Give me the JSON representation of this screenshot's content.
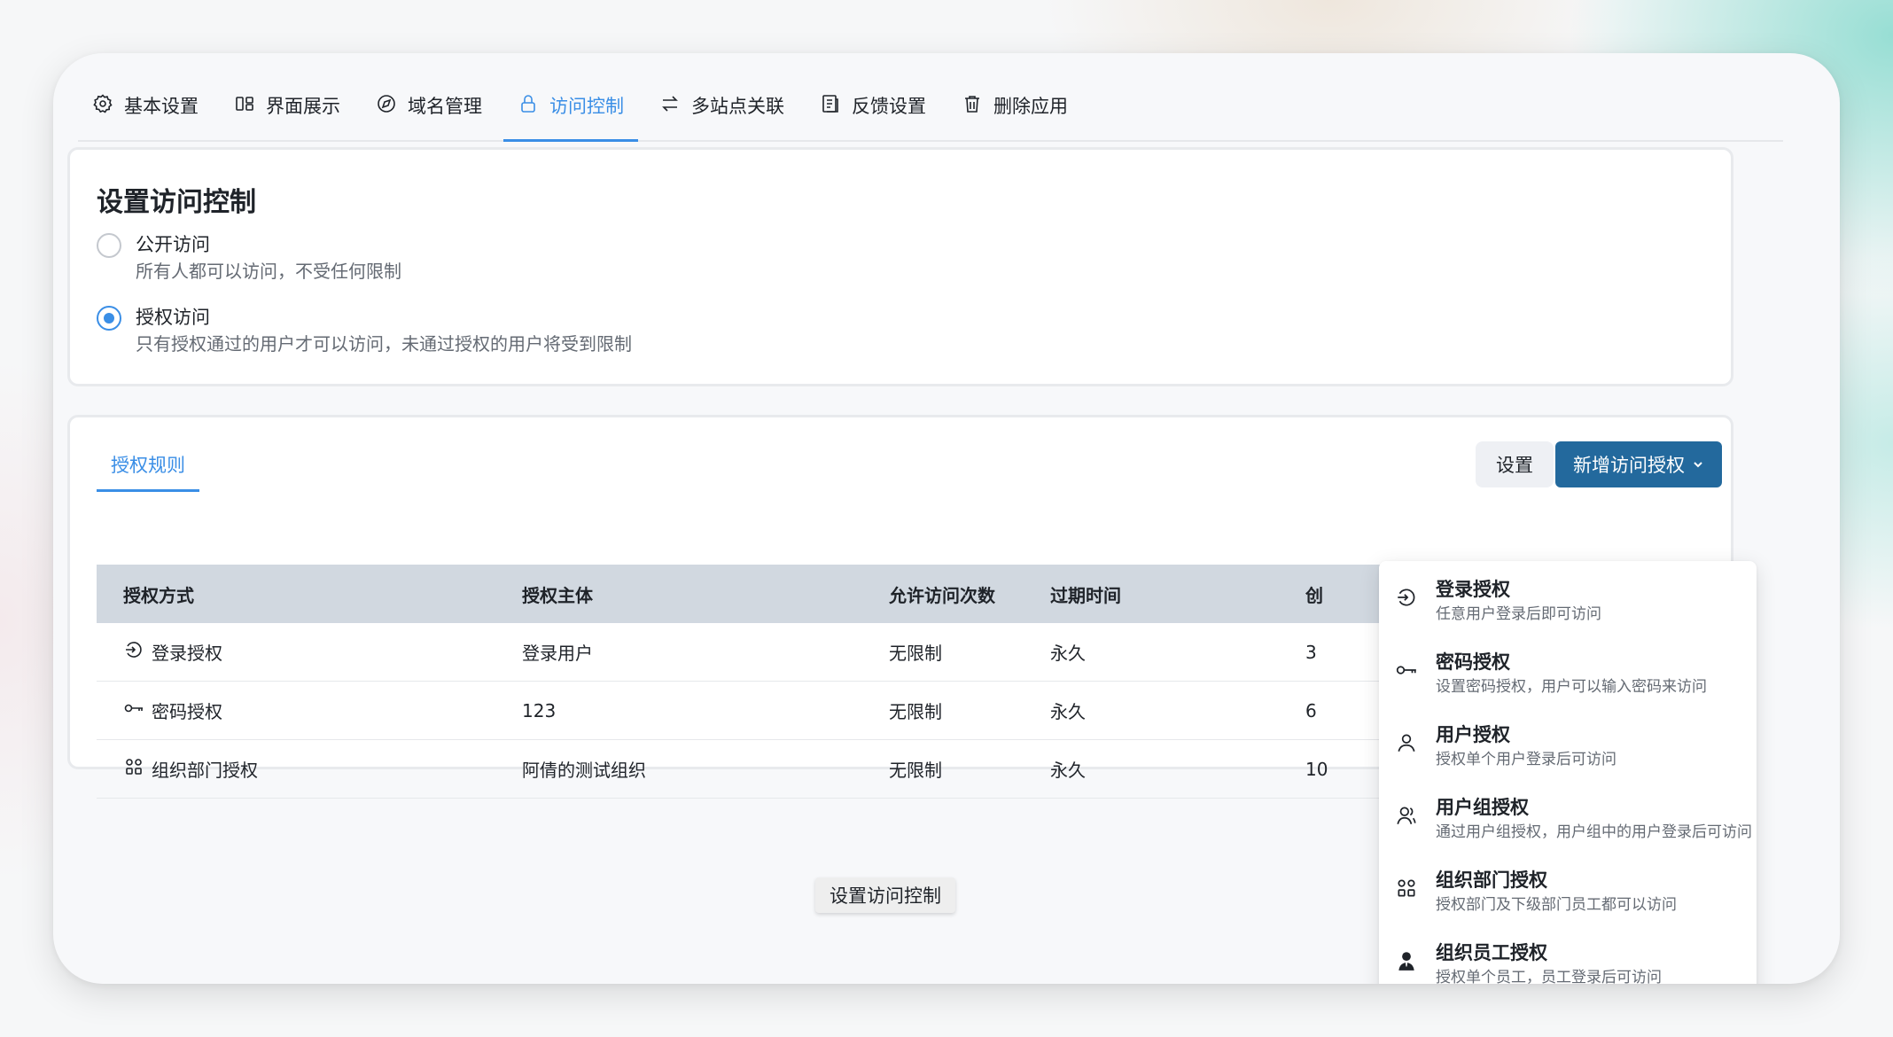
{
  "tabs": [
    {
      "label": "基本设置",
      "icon": "gear-icon"
    },
    {
      "label": "界面展示",
      "icon": "layout-icon"
    },
    {
      "label": "域名管理",
      "icon": "compass-icon"
    },
    {
      "label": "访问控制",
      "icon": "lock-icon",
      "active": true
    },
    {
      "label": "多站点关联",
      "icon": "swap-icon"
    },
    {
      "label": "反馈设置",
      "icon": "document-icon"
    },
    {
      "label": "删除应用",
      "icon": "trash-icon"
    }
  ],
  "access": {
    "title": "设置访问控制",
    "options": [
      {
        "label": "公开访问",
        "desc": "所有人都可以访问，不受任何限制",
        "checked": false
      },
      {
        "label": "授权访问",
        "desc": "只有授权通过的用户才可以访问，未通过授权的用户将受到限制",
        "checked": true
      }
    ]
  },
  "rules": {
    "tab_label": "授权规则",
    "settings_label": "设置",
    "add_label": "新增访问授权",
    "columns": [
      "授权方式",
      "授权主体",
      "允许访问次数",
      "过期时间",
      "创"
    ],
    "rows": [
      {
        "type": "登录授权",
        "icon": "login-icon",
        "subject": "登录用户",
        "count": "无限制",
        "expire": "永久",
        "created": "3"
      },
      {
        "type": "密码授权",
        "icon": "key-icon",
        "subject": "123",
        "count": "无限制",
        "expire": "永久",
        "created": "6"
      },
      {
        "type": "组织部门授权",
        "icon": "org-icon",
        "subject": "阿倩的测试组织",
        "count": "无限制",
        "expire": "永久",
        "created": "10"
      }
    ]
  },
  "save_label": "设置访问控制",
  "dropdown": [
    {
      "title": "登录授权",
      "desc": "任意用户登录后即可访问",
      "icon": "login-icon"
    },
    {
      "title": "密码授权",
      "desc": "设置密码授权，用户可以输入密码来访问",
      "icon": "key-icon"
    },
    {
      "title": "用户授权",
      "desc": "授权单个用户登录后可访问",
      "icon": "user-icon"
    },
    {
      "title": "用户组授权",
      "desc": "通过用户组授权，用户组中的用户登录后可访问",
      "icon": "user-group-icon"
    },
    {
      "title": "组织部门授权",
      "desc": "授权部门及下级部门员工都可以访问",
      "icon": "org-icon"
    },
    {
      "title": "组织员工授权",
      "desc": "授权单个员工，员工登录后可访问",
      "icon": "employee-icon"
    }
  ],
  "colors": {
    "accent": "#3a8ee6",
    "primary_button": "#23699d",
    "table_header": "#d1d8e0"
  }
}
